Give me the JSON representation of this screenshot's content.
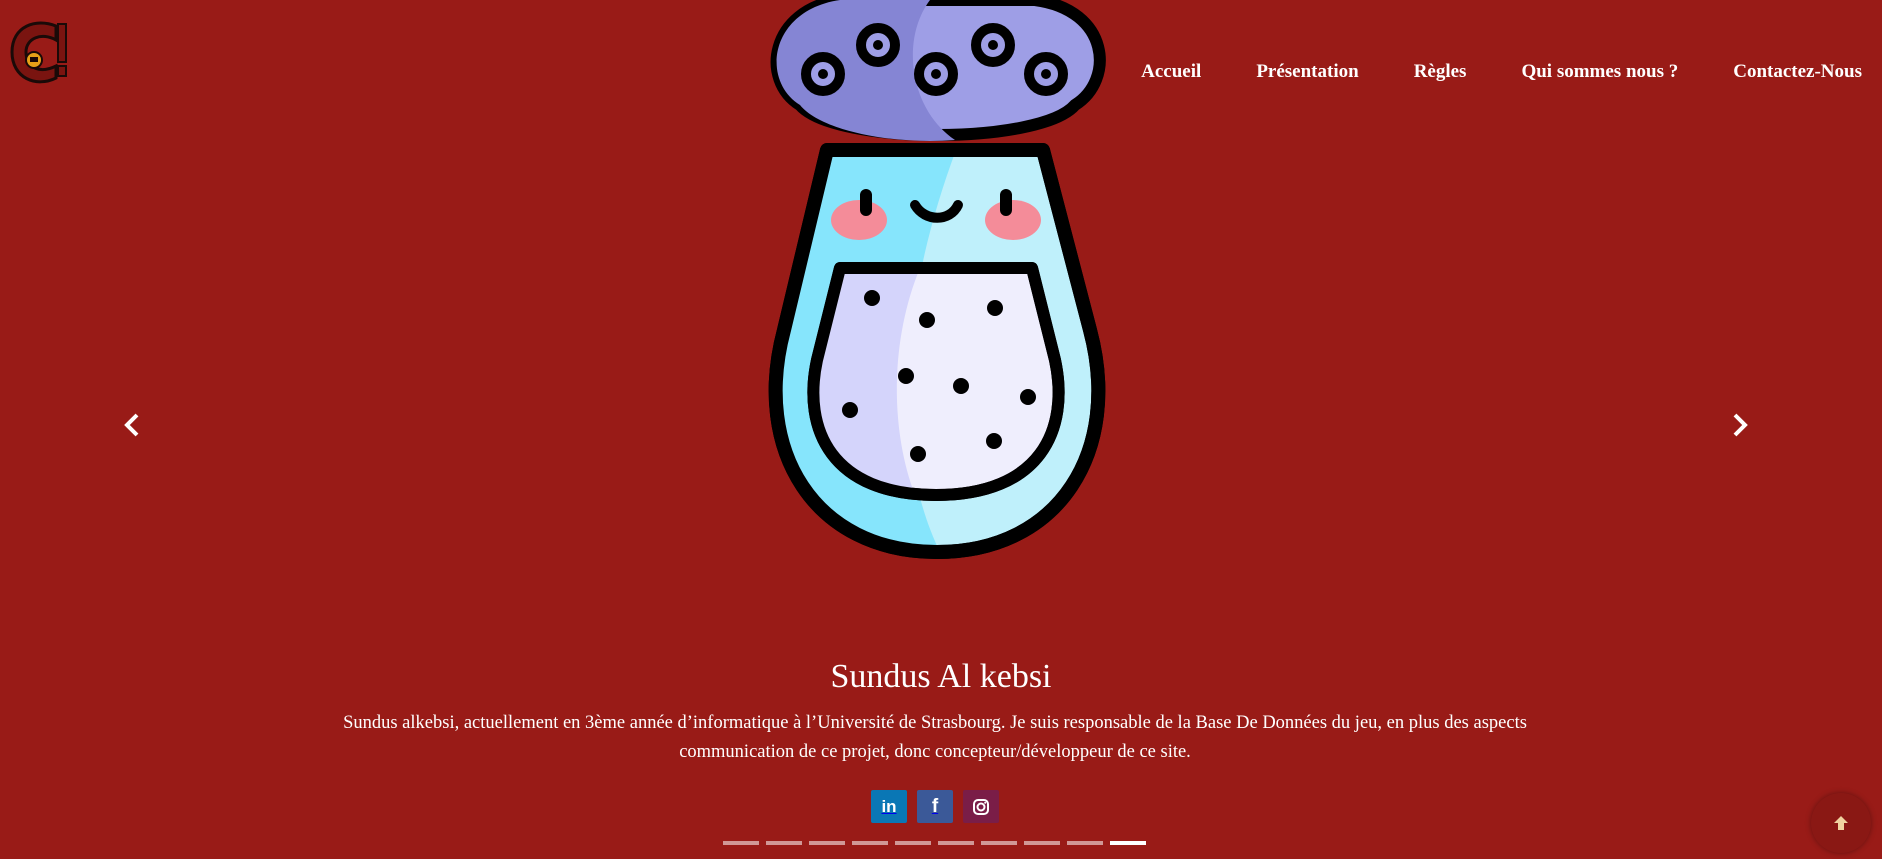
{
  "nav": {
    "items": [
      {
        "label": "Accueil"
      },
      {
        "label": "Présentation"
      },
      {
        "label": "Règles"
      },
      {
        "label": "Qui sommes nous ?"
      },
      {
        "label": "Contactez-Nous"
      }
    ]
  },
  "carousel": {
    "member_name": "Sundus Al kebsi",
    "member_description": "Sundus alkebsi, actuellement en 3ème année d’informatique à l’Université de Strasbourg. Je suis responsable de la Base De Données du jeu, en plus des aspects communication de ce projet, donc concepteur/développeur de ce site.",
    "illustration": "salt-shaker-mascot",
    "slide_count": 10,
    "active_slide": 10
  },
  "social": [
    {
      "icon": "linkedin-icon",
      "label": "in"
    },
    {
      "icon": "facebook-icon",
      "label": "f"
    },
    {
      "icon": "instagram-icon",
      "label": ""
    }
  ],
  "colors": {
    "background": "#991b17",
    "text": "#ffffff",
    "linkedin": "#0a77b5",
    "facebook": "#3b5998",
    "instagram": "#7a1d47"
  }
}
